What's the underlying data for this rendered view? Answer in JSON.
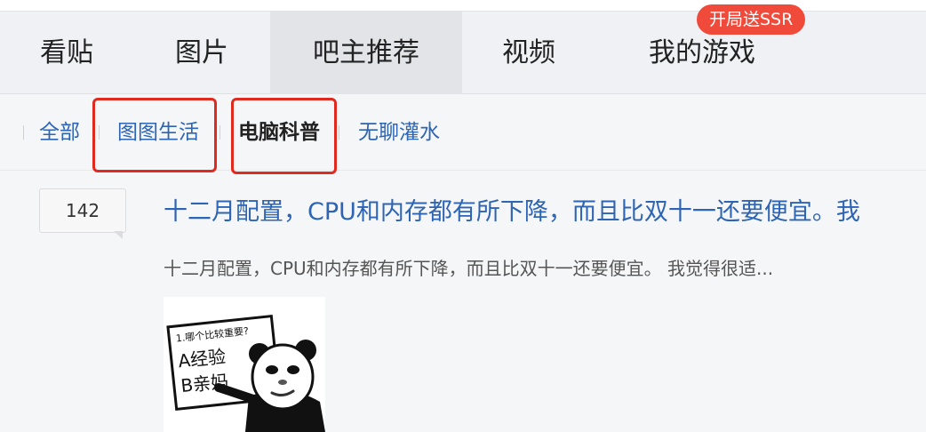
{
  "nav": {
    "tabs": [
      {
        "label": "看贴"
      },
      {
        "label": "图片"
      },
      {
        "label": "吧主推荐",
        "active": true
      },
      {
        "label": "视频"
      },
      {
        "label": "我的游戏"
      }
    ],
    "promo_badge": "开局送SSR"
  },
  "filters": {
    "items": [
      {
        "label": "全部"
      },
      {
        "label": "图图生活",
        "highlighted": true
      },
      {
        "label": "电脑科普",
        "active": true,
        "highlighted": true
      },
      {
        "label": "无聊灌水"
      }
    ]
  },
  "post": {
    "reply_count": "142",
    "title": "十二月配置，CPU和内存都有所下降，而且比双十一还要便宜。我",
    "excerpt": "十二月配置，CPU和内存都有所下降，而且比双十一还要便宜。 我觉得很适...",
    "image": {
      "question": "1.哪个比较重要?",
      "option_a": "A经验",
      "option_b": "B亲妈"
    }
  },
  "colors": {
    "link": "#2d64b3",
    "badge": "#f04a3b",
    "highlight_box": "#e02a1f",
    "nav_bg": "#f0f1f4",
    "active_tab_bg": "#e3e4e8"
  }
}
